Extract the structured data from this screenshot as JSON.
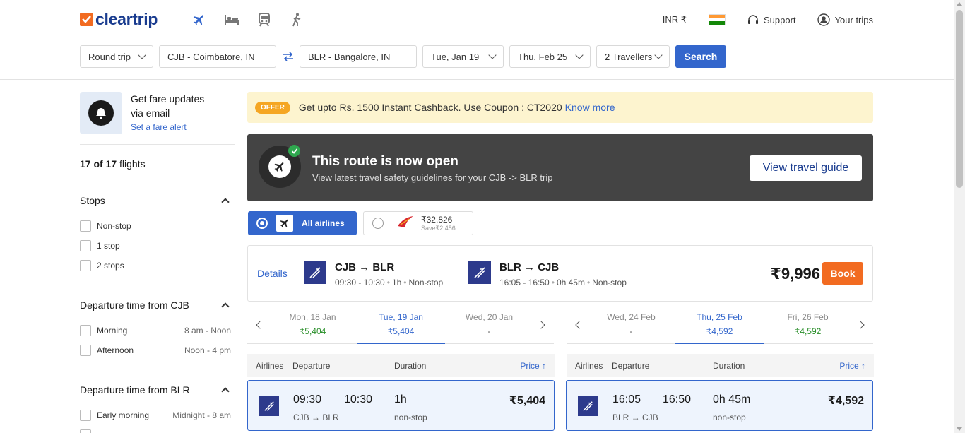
{
  "brand": {
    "logo_text": "cleartrip"
  },
  "nav": {
    "icons": [
      "flight-icon",
      "hotel-icon",
      "train-icon",
      "activities-icon"
    ]
  },
  "topbar": {
    "currency": "INR ₹",
    "support": "Support",
    "trips": "Your trips"
  },
  "search": {
    "trip_type": "Round trip",
    "from": "CJB - Coimbatore, IN",
    "to": "BLR - Bangalore, IN",
    "depart": "Tue, Jan 19",
    "return": "Thu, Feb 25",
    "travellers": "2 Travellers",
    "button": "Search"
  },
  "sidebar": {
    "fare_title": "Get fare updates via email",
    "fare_link": "Set a fare alert",
    "count_num": "17 of 17",
    "count_label": " flights",
    "stops_title": "Stops",
    "stops": [
      "Non-stop",
      "1 stop",
      "2 stops"
    ],
    "dep_cjb_title": "Departure time from CJB",
    "dep_cjb": [
      {
        "label": "Morning",
        "range": "8 am - Noon"
      },
      {
        "label": "Afternoon",
        "range": "Noon - 4 pm"
      }
    ],
    "dep_blr_title": "Departure time from BLR",
    "dep_blr": [
      {
        "label": "Early morning",
        "range": "Midnight - 8 am"
      }
    ]
  },
  "offer": {
    "badge": "OFFER",
    "text": "Get upto Rs. 1500 Instant Cashback. Use Coupon : CT2020",
    "link": "Know more"
  },
  "route_open": {
    "title": "This route is now open",
    "subtitle": "View latest travel safety guidelines for your CJB -> BLR trip",
    "button": "View travel guide"
  },
  "airline_tabs": {
    "all_label": "All airlines",
    "other_price": "₹32,826",
    "other_save": "Save₹2,456"
  },
  "summary": {
    "details": "Details",
    "outbound_route": "CJB → BLR",
    "outbound_time": "09:30 - 10:30",
    "outbound_dur": "1h",
    "outbound_stops": "Non-stop",
    "return_route": "BLR → CJB",
    "return_time": "16:05 - 16:50",
    "return_dur": "0h 45m",
    "return_stops": "Non-stop",
    "total": "₹9,996",
    "book": "Book"
  },
  "dates_out": [
    {
      "d": "Mon, 18 Jan",
      "p": "₹5,404"
    },
    {
      "d": "Tue, 19 Jan",
      "p": "₹5,404"
    },
    {
      "d": "Wed, 20 Jan",
      "p": "-"
    }
  ],
  "dates_ret": [
    {
      "d": "Wed, 24 Feb",
      "p": "-"
    },
    {
      "d": "Thu, 25 Feb",
      "p": "₹4,592"
    },
    {
      "d": "Fri, 26 Feb",
      "p": "₹4,592"
    }
  ],
  "columns": {
    "airlines": "Airlines",
    "departure": "Departure",
    "duration": "Duration",
    "price": "Price ↑"
  },
  "flight_out": {
    "dep": "09:30",
    "arr": "10:30",
    "route": "CJB → BLR",
    "dur": "1h",
    "stops": "non-stop",
    "price": "₹5,404"
  },
  "flight_ret": {
    "dep": "16:05",
    "arr": "16:50",
    "route": "BLR → CJB",
    "dur": "0h 45m",
    "stops": "non-stop",
    "price": "₹4,592"
  }
}
